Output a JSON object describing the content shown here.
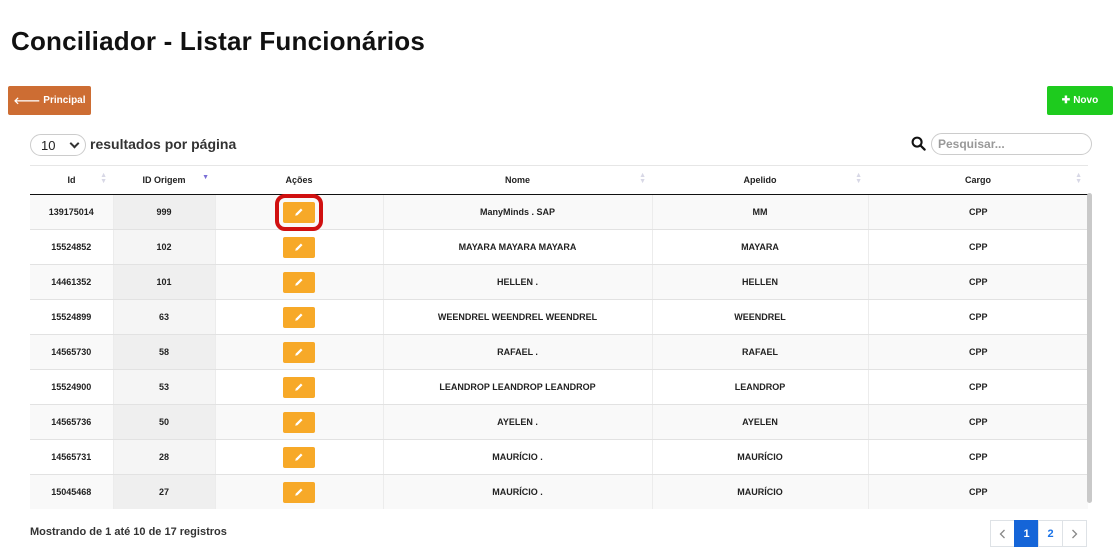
{
  "page": {
    "title": "Conciliador - Listar Funcionários"
  },
  "toolbar": {
    "principal_icon": "arrow-left-icon",
    "principal_label": "Principal",
    "principal_color": "#cd6d33",
    "novo_icon": "plus-icon",
    "novo_label": "Novo",
    "novo_color": "#1ecb1e"
  },
  "length": {
    "selected": "10",
    "label": "resultados por página"
  },
  "search": {
    "placeholder": "Pesquisar...",
    "value": ""
  },
  "table": {
    "columns": [
      "Id",
      "ID Origem",
      "Ações",
      "Nome",
      "Apelido",
      "Cargo"
    ],
    "sorted_column": "ID Origem",
    "rows": [
      {
        "id": "139175014",
        "origem": "999",
        "nome": "ManyMinds . SAP",
        "apelido": "MM",
        "cargo": "CPP"
      },
      {
        "id": "15524852",
        "origem": "102",
        "nome": "MAYARA MAYARA MAYARA",
        "apelido": "MAYARA",
        "cargo": "CPP"
      },
      {
        "id": "14461352",
        "origem": "101",
        "nome": "HELLEN .",
        "apelido": "HELLEN",
        "cargo": "CPP"
      },
      {
        "id": "15524899",
        "origem": "63",
        "nome": "WEENDREL WEENDREL WEENDREL",
        "apelido": "WEENDREL",
        "cargo": "CPP"
      },
      {
        "id": "14565730",
        "origem": "58",
        "nome": "RAFAEL .",
        "apelido": "RAFAEL",
        "cargo": "CPP"
      },
      {
        "id": "15524900",
        "origem": "53",
        "nome": "LEANDROP LEANDROP LEANDROP",
        "apelido": "LEANDROP",
        "cargo": "CPP"
      },
      {
        "id": "14565736",
        "origem": "50",
        "nome": "AYELEN .",
        "apelido": "AYELEN",
        "cargo": "CPP"
      },
      {
        "id": "14565731",
        "origem": "28",
        "nome": "MAURÍCIO .",
        "apelido": "MAURÍCIO",
        "cargo": "CPP"
      },
      {
        "id": "15045468",
        "origem": "27",
        "nome": "MAURÍCIO .",
        "apelido": "MAURÍCIO",
        "cargo": "CPP"
      }
    ],
    "edit_icon": "pencil-icon",
    "edit_color": "#f7a928",
    "highlight_color": "#d01010"
  },
  "footer": {
    "info": "Mostrando de 1 até 10 de 17 registros",
    "pages": [
      "1",
      "2"
    ],
    "current_page": "1",
    "prev_icon": "chevron-left-icon",
    "next_icon": "chevron-right-icon"
  }
}
